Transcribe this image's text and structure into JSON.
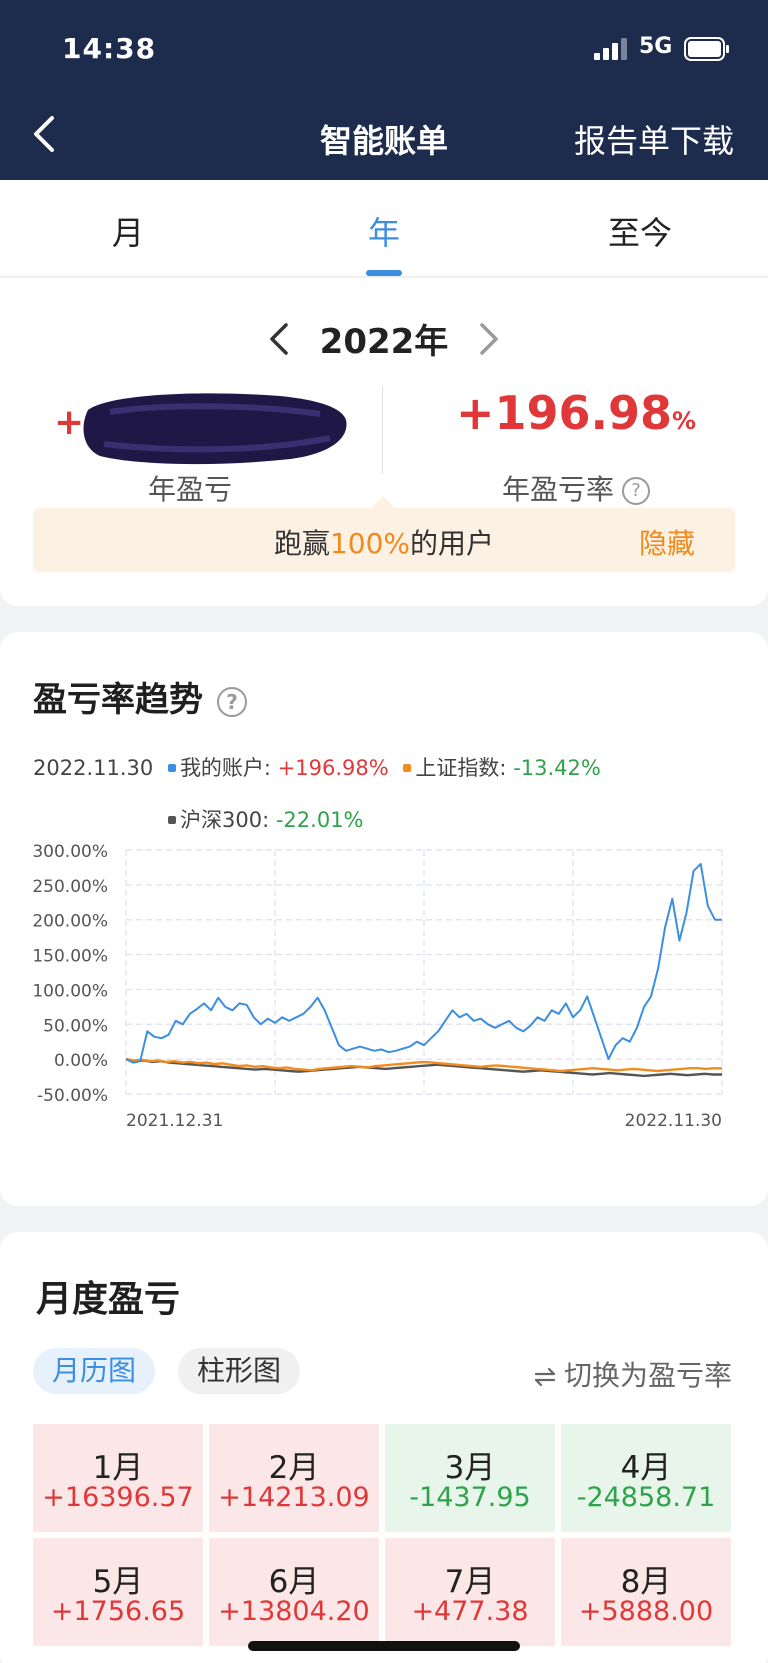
{
  "status_bar": {
    "time": "14:38",
    "network": "5G"
  },
  "nav": {
    "title": "智能账单",
    "download": "报告单下载"
  },
  "tabs": [
    {
      "label": "月",
      "active": false
    },
    {
      "label": "年",
      "active": true
    },
    {
      "label": "至今",
      "active": false
    }
  ],
  "summary": {
    "year": "2022年",
    "profit_sign": "+",
    "profit_label": "年盈亏",
    "rate": "+196.98",
    "rate_unit": "%",
    "rate_label": "年盈亏率",
    "banner_prefix": "跑赢",
    "banner_highlight": "100%",
    "banner_suffix": "的用户",
    "banner_hide": "隐藏"
  },
  "trend": {
    "title": "盈亏率趋势",
    "date": "2022.11.30",
    "legend": [
      {
        "name": "我的账户:",
        "value": "+196.98%",
        "color": "#3c8ee0"
      },
      {
        "name": "上证指数:",
        "value": "-13.42%",
        "color": "#f28c1e"
      },
      {
        "name": "沪深300:",
        "value": "-22.01%",
        "color": "#555555"
      }
    ]
  },
  "chart_data": {
    "type": "line",
    "title": "",
    "xlabel": "",
    "ylabel": "",
    "x_range": [
      "2021.12.31",
      "2022.11.30"
    ],
    "x_tick_labels": [
      "2021.12.31",
      "2022.11.30"
    ],
    "y_tick_labels": [
      "300.00%",
      "250.00%",
      "200.00%",
      "150.00%",
      "100.00%",
      "50.00%",
      "0.00%",
      "-50.00%"
    ],
    "ylim": [
      -50,
      300
    ],
    "grid": true,
    "series": [
      {
        "name": "我的账户",
        "color": "#3c8ee0",
        "values": [
          0,
          -5,
          -3,
          40,
          32,
          30,
          35,
          55,
          50,
          65,
          72,
          80,
          70,
          88,
          75,
          70,
          80,
          78,
          60,
          50,
          58,
          52,
          60,
          55,
          60,
          65,
          75,
          88,
          70,
          45,
          20,
          12,
          15,
          18,
          15,
          12,
          14,
          10,
          12,
          15,
          18,
          25,
          20,
          30,
          40,
          55,
          70,
          60,
          65,
          55,
          58,
          50,
          45,
          50,
          55,
          45,
          40,
          48,
          60,
          55,
          70,
          65,
          80,
          60,
          70,
          90,
          60,
          30,
          0,
          20,
          30,
          25,
          45,
          75,
          90,
          130,
          190,
          230,
          170,
          210,
          270,
          280,
          220,
          200,
          200
        ]
      },
      {
        "name": "上证指数",
        "color": "#f28c1e",
        "values": [
          0,
          -2,
          -1,
          -3,
          -2,
          -4,
          -3,
          -5,
          -4,
          -6,
          -5,
          -7,
          -6,
          -8,
          -10,
          -9,
          -11,
          -10,
          -12,
          -13,
          -12,
          -14,
          -15,
          -16,
          -14,
          -13,
          -12,
          -11,
          -10,
          -11,
          -12,
          -10,
          -9,
          -8,
          -7,
          -6,
          -5,
          -4,
          -5,
          -6,
          -7,
          -8,
          -9,
          -10,
          -11,
          -10,
          -9,
          -10,
          -11,
          -12,
          -13,
          -14,
          -15,
          -16,
          -17,
          -16,
          -15,
          -14,
          -13,
          -14,
          -15,
          -16,
          -15,
          -14,
          -15,
          -16,
          -17,
          -16,
          -15,
          -14,
          -13,
          -13,
          -14,
          -13,
          -13.42
        ]
      },
      {
        "name": "沪深300",
        "color": "#555555",
        "values": [
          0,
          -3,
          -2,
          -4,
          -3,
          -5,
          -6,
          -7,
          -8,
          -9,
          -10,
          -11,
          -12,
          -13,
          -14,
          -15,
          -14,
          -15,
          -16,
          -17,
          -18,
          -17,
          -16,
          -15,
          -14,
          -13,
          -12,
          -11,
          -12,
          -13,
          -14,
          -13,
          -12,
          -11,
          -10,
          -9,
          -8,
          -9,
          -10,
          -11,
          -12,
          -13,
          -14,
          -15,
          -16,
          -17,
          -18,
          -17,
          -16,
          -17,
          -18,
          -19,
          -20,
          -21,
          -22,
          -21,
          -20,
          -21,
          -22,
          -23,
          -24,
          -23,
          -22,
          -21,
          -22,
          -23,
          -22,
          -21,
          -22,
          -22.01
        ]
      }
    ]
  },
  "monthly": {
    "title": "月度盈亏",
    "tab_calendar": "月历图",
    "tab_bar": "柱形图",
    "switch_label": "切换为盈亏率",
    "cells": [
      {
        "month": "1月",
        "value": "+16396.57",
        "sign": "pos"
      },
      {
        "month": "2月",
        "value": "+14213.09",
        "sign": "pos"
      },
      {
        "month": "3月",
        "value": "-1437.95",
        "sign": "neg"
      },
      {
        "month": "4月",
        "value": "-24858.71",
        "sign": "neg"
      },
      {
        "month": "5月",
        "value": "+1756.65",
        "sign": "pos"
      },
      {
        "month": "6月",
        "value": "+13804.20",
        "sign": "pos"
      },
      {
        "month": "7月",
        "value": "+477.38",
        "sign": "pos"
      },
      {
        "month": "8月",
        "value": "+5888.00",
        "sign": "pos"
      }
    ]
  }
}
